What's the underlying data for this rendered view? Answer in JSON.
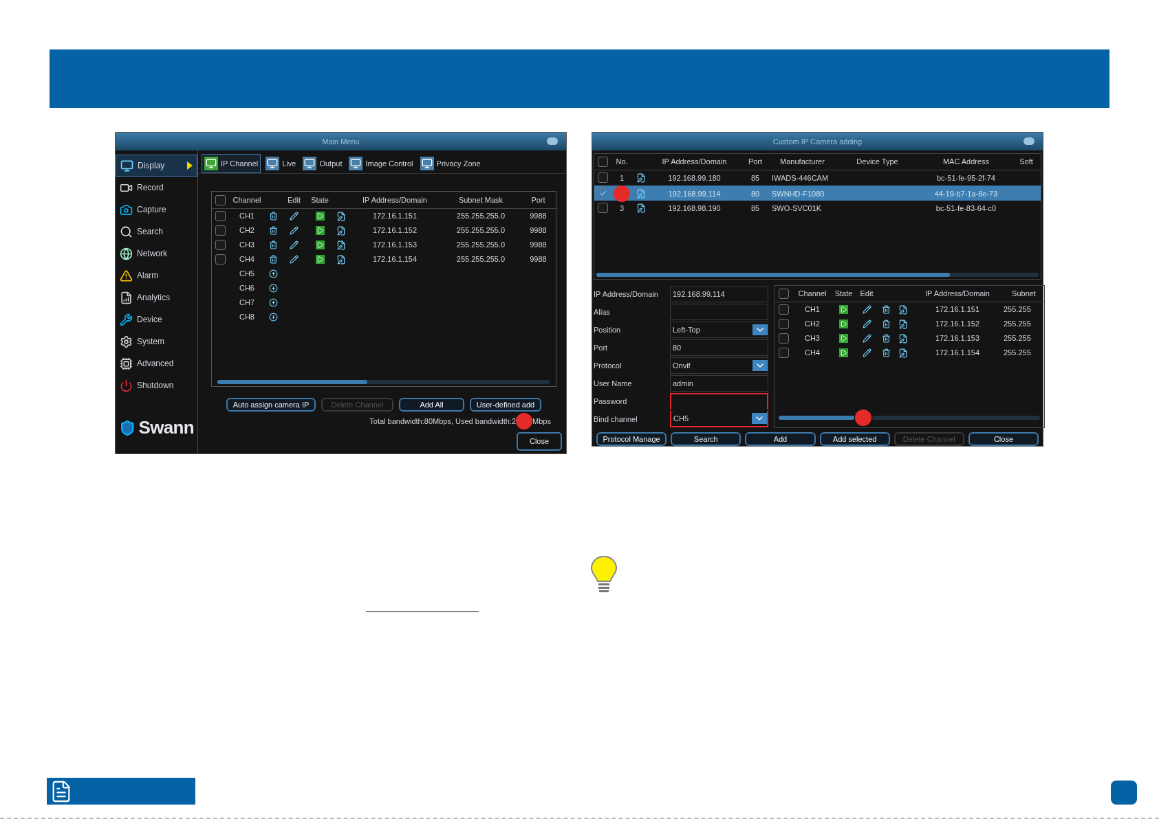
{
  "left_window": {
    "title": "Main Menu",
    "sidebar": [
      {
        "label": "Display",
        "selected": true
      },
      {
        "label": "Record",
        "selected": false
      },
      {
        "label": "Capture",
        "selected": false
      },
      {
        "label": "Search",
        "selected": false
      },
      {
        "label": "Network",
        "selected": false
      },
      {
        "label": "Alarm",
        "selected": false
      },
      {
        "label": "Analytics",
        "selected": false
      },
      {
        "label": "Device",
        "selected": false
      },
      {
        "label": "System",
        "selected": false
      },
      {
        "label": "Advanced",
        "selected": false
      },
      {
        "label": "Shutdown",
        "selected": false
      }
    ],
    "logo": "Swann",
    "tabs": [
      {
        "label": "IP Channel",
        "selected": true
      },
      {
        "label": "Live",
        "selected": false
      },
      {
        "label": "Output",
        "selected": false
      },
      {
        "label": "Image Control",
        "selected": false
      },
      {
        "label": "Privacy Zone",
        "selected": false
      }
    ],
    "table": {
      "select_all_checked": false,
      "columns": [
        "Channel",
        "Edit",
        "State",
        "IP Address/Domain",
        "Subnet Mask",
        "Port"
      ],
      "rows": [
        {
          "kind": "assigned",
          "checked": false,
          "channel": "CH1",
          "ip": "172.16.1.151",
          "mask": "255.255.255.0",
          "port": "9988"
        },
        {
          "kind": "assigned",
          "checked": false,
          "channel": "CH2",
          "ip": "172.16.1.152",
          "mask": "255.255.255.0",
          "port": "9988"
        },
        {
          "kind": "assigned",
          "checked": false,
          "channel": "CH3",
          "ip": "172.16.1.153",
          "mask": "255.255.255.0",
          "port": "9988"
        },
        {
          "kind": "assigned",
          "checked": false,
          "channel": "CH4",
          "ip": "172.16.1.154",
          "mask": "255.255.255.0",
          "port": "9988"
        },
        {
          "kind": "empty",
          "channel": "CH5"
        },
        {
          "kind": "empty",
          "channel": "CH6"
        },
        {
          "kind": "empty",
          "channel": "CH7"
        },
        {
          "kind": "empty",
          "channel": "CH8"
        }
      ]
    },
    "buttons": [
      {
        "label": "Auto assign camera IP",
        "disabled": false
      },
      {
        "label": "Delete Channel",
        "disabled": true
      },
      {
        "label": "Add All",
        "disabled": false
      },
      {
        "label": "User-defined add",
        "disabled": false
      }
    ],
    "bandwidth_text": "Total bandwidth:80Mbps, Used bandwidth:2",
    "bandwidth_unit": "Mbps",
    "close_button": "Close"
  },
  "right_window": {
    "title": "Custom IP Camera adding",
    "camera_table": {
      "select_all_checked": false,
      "columns": [
        "No.",
        "IP Address/Domain",
        "Port",
        "Manufacturer",
        "Device Type",
        "MAC Address",
        "Soft"
      ],
      "rows": [
        {
          "checked": false,
          "selected": false,
          "no": "1",
          "ip": "192.168.99.180",
          "port": "85",
          "manufacturer": "IWADS-446CAM",
          "mac": "bc-51-fe-95-2f-74"
        },
        {
          "checked": true,
          "selected": true,
          "ip": "192.168.99.114",
          "port": "80",
          "manufacturer": "SWNHD-F1080",
          "mac": "44-19-b7-1a-8e-73"
        },
        {
          "checked": false,
          "selected": false,
          "no": "3",
          "ip": "192.168.98.190",
          "port": "85",
          "manufacturer": "SWO-SVC01K",
          "mac": "bc-51-fe-83-64-c0"
        }
      ]
    },
    "form": [
      {
        "label": "IP Address/Domain",
        "kind": "text",
        "value": "192.168.99.114",
        "highlighted": false
      },
      {
        "label": "Alias",
        "kind": "text",
        "highlighted": false
      },
      {
        "label": "Position",
        "kind": "dropdown",
        "value": "Left-Top",
        "highlighted": false
      },
      {
        "label": "Port",
        "kind": "text",
        "value": "80",
        "highlighted": false
      },
      {
        "label": "Protocol",
        "kind": "dropdown",
        "value": "Onvif",
        "highlighted": false
      },
      {
        "label": "User Name",
        "kind": "text",
        "value": "admin",
        "highlighted": false
      },
      {
        "label": "Password",
        "kind": "text",
        "highlighted": true
      },
      {
        "label": "Bind channel",
        "kind": "dropdown",
        "value": "CH5",
        "highlighted": true
      }
    ],
    "channel_table": {
      "select_all_checked": false,
      "columns": [
        "Channel",
        "State",
        "Edit",
        "IP Address/Domain",
        "Subnet"
      ],
      "rows": [
        {
          "checked": false,
          "channel": "CH1",
          "ip": "172.16.1.151",
          "mask": "255.255"
        },
        {
          "checked": false,
          "channel": "CH2",
          "ip": "172.16.1.152",
          "mask": "255.255"
        },
        {
          "checked": false,
          "channel": "CH3",
          "ip": "172.16.1.153",
          "mask": "255.255"
        },
        {
          "checked": false,
          "channel": "CH4",
          "ip": "172.16.1.154",
          "mask": "255.255"
        }
      ]
    },
    "buttons": [
      {
        "label": "Protocol Manage",
        "disabled": false
      },
      {
        "label": "Search",
        "disabled": false
      },
      {
        "label": "Add",
        "disabled": false
      },
      {
        "label": "Add selected",
        "disabled": false
      },
      {
        "label": "Delete Channel",
        "disabled": true
      },
      {
        "label": "Close",
        "disabled": false
      }
    ]
  }
}
